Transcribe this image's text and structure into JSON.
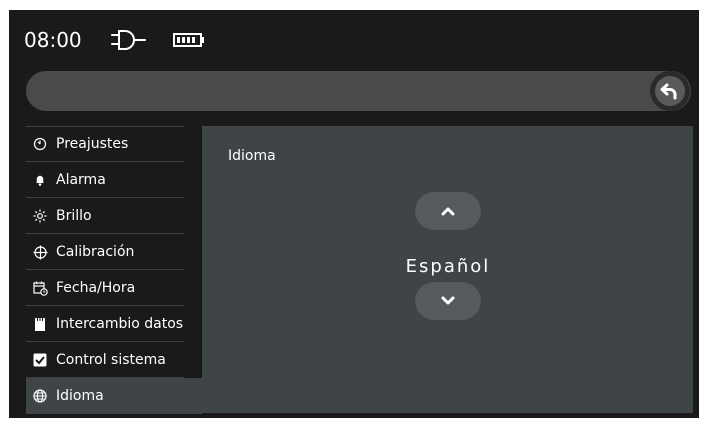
{
  "status": {
    "time": "08:00",
    "icons": [
      "plug-icon",
      "battery-icon"
    ]
  },
  "titlebar": {
    "text": "",
    "back_icon": "back-arrow-icon"
  },
  "sidebar": {
    "items": [
      {
        "label": "Preajustes",
        "icon": "timer-icon"
      },
      {
        "label": "Alarma",
        "icon": "bell-icon"
      },
      {
        "label": "Brillo",
        "icon": "sun-icon"
      },
      {
        "label": "Calibración",
        "icon": "crosshair-icon"
      },
      {
        "label": "Fecha/Hora",
        "icon": "calendar-clock-icon"
      },
      {
        "label": "Intercambio datos",
        "icon": "sd-card-icon"
      },
      {
        "label": "Control sistema",
        "icon": "checkbox-icon"
      },
      {
        "label": "Idioma",
        "icon": "globe-icon",
        "active": true
      }
    ]
  },
  "panel": {
    "title": "Idioma",
    "value": "Español",
    "up_icon": "chevron-up-icon",
    "down_icon": "chevron-down-icon"
  },
  "colors": {
    "screen_bg": "#1a1a1a",
    "panel_bg": "#3f4447",
    "pill_bg": "#555a5d",
    "titlebar_bg": "#4a4a4a"
  }
}
